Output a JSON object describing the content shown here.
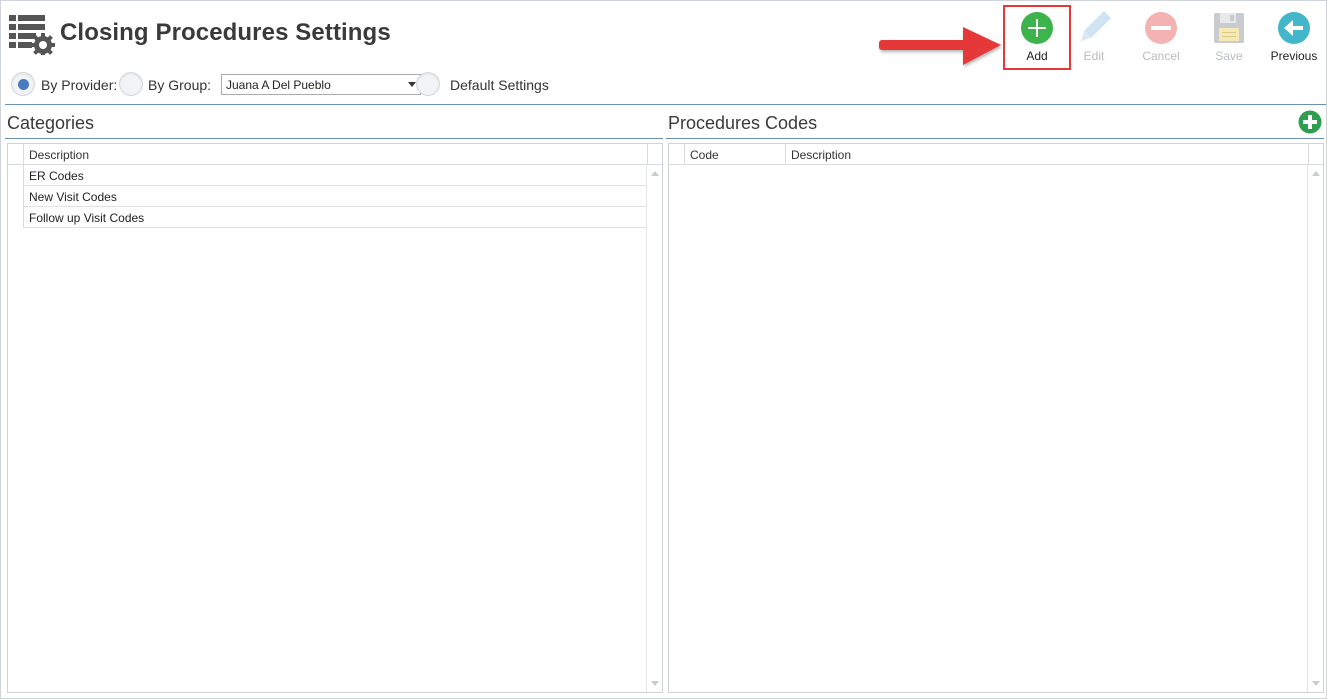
{
  "header": {
    "title": "Closing Procedures Settings",
    "icon": "list-settings-icon"
  },
  "toolbar": {
    "add": {
      "label": "Add",
      "icon": "plus-circle-icon",
      "enabled": true,
      "color": "#3cb44b"
    },
    "edit": {
      "label": "Edit",
      "icon": "pencil-icon",
      "enabled": false
    },
    "cancel": {
      "label": "Cancel",
      "icon": "minus-circle-icon",
      "enabled": false
    },
    "save": {
      "label": "Save",
      "icon": "floppy-disk-icon",
      "enabled": false
    },
    "previous": {
      "label": "Previous",
      "icon": "arrow-left-circle-icon",
      "enabled": true,
      "color": "#43b6c9"
    }
  },
  "filters": {
    "by_provider": {
      "label": "By Provider:",
      "checked": true
    },
    "by_group": {
      "label": "By Group:",
      "checked": false
    },
    "group_select": {
      "value": "Juana A Del Pueblo"
    },
    "default_settings": {
      "label": "Default Settings",
      "checked": false
    }
  },
  "categories": {
    "title": "Categories",
    "columns": [
      "Description"
    ],
    "rows": [
      "ER Codes",
      "New Visit Codes",
      "Follow up Visit Codes"
    ]
  },
  "procedures": {
    "title": "Procedures Codes",
    "columns": [
      "Code",
      "Description"
    ],
    "rows": [],
    "add_icon": "plus-circle-icon"
  },
  "colors": {
    "accent_blue": "#4a7abf",
    "highlight_red": "#e53838",
    "add_green": "#3cb44b"
  }
}
